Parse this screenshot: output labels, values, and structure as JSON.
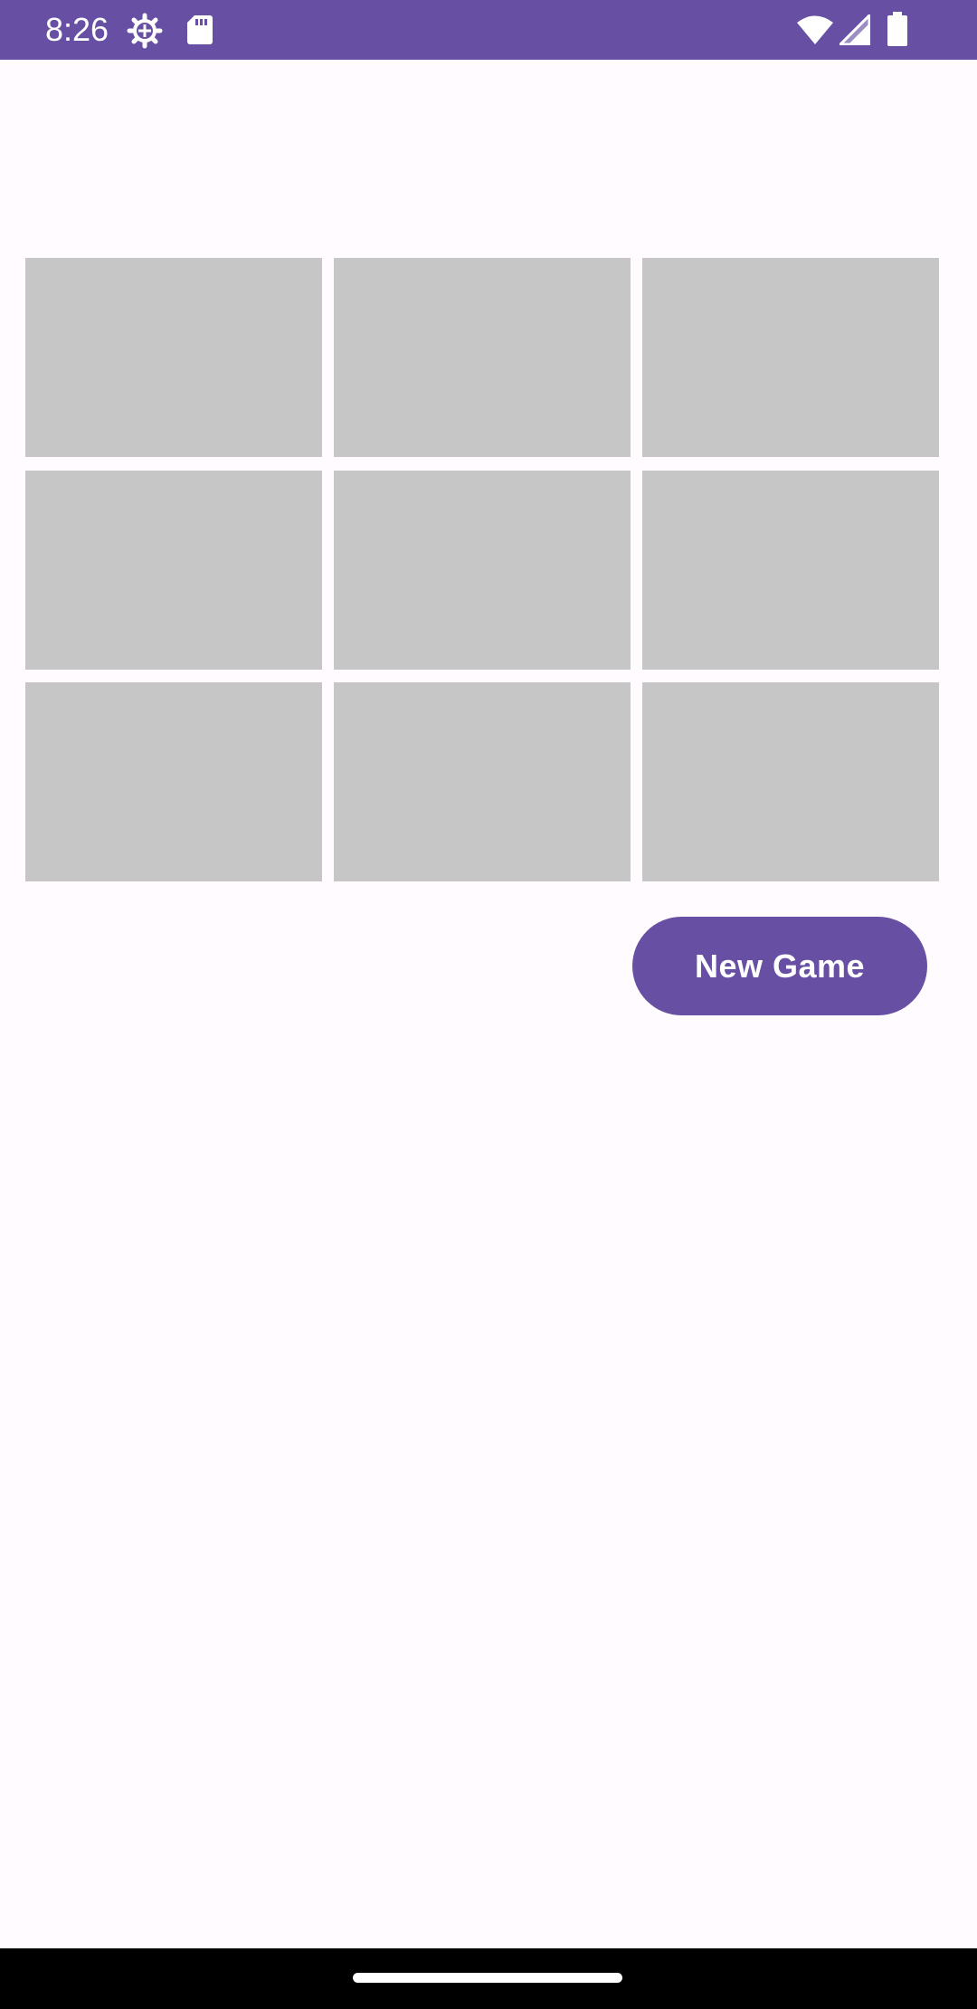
{
  "status_bar": {
    "time": "8:26",
    "icons": [
      "settings-icon",
      "sd-card-icon",
      "wifi-icon",
      "cell-signal-icon",
      "battery-icon"
    ]
  },
  "board": {
    "cells": [
      [
        "",
        "",
        ""
      ],
      [
        "",
        "",
        ""
      ],
      [
        "",
        "",
        ""
      ]
    ]
  },
  "actions": {
    "new_game_label": "New Game"
  },
  "colors": {
    "accent": "#6750a4",
    "cell": "#c7c6c6",
    "background": "#fffbfe"
  }
}
